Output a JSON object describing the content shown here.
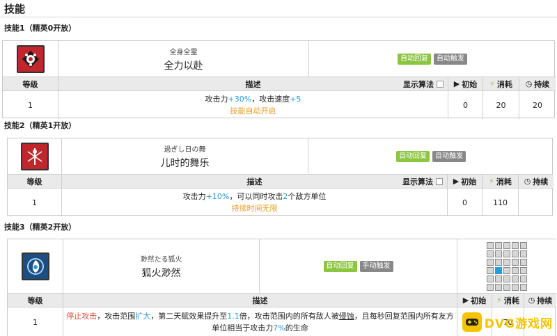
{
  "page": {
    "title": "技能"
  },
  "table_headers": {
    "level": "等级",
    "desc": "描述",
    "show_formula": "显示算法",
    "initial": "初始",
    "cost": "消耗",
    "duration": "持续"
  },
  "skills": [
    {
      "heading": "技能1（精英0开放）",
      "name_jp": "全身全霊",
      "name_cn": "全力以赴",
      "recovery_tag": "自动回复",
      "trigger_tag": "自动触发",
      "level": "1",
      "desc_line1_a": "攻击力",
      "desc_line1_b": "+30%",
      "desc_line1_c": "，攻击速度",
      "desc_line1_d": "+5",
      "desc_line2": "技能自动开启",
      "initial": "0",
      "cost": "20",
      "duration": "20",
      "icon_color": "#c0272d"
    },
    {
      "heading": "技能2（精英1开放）",
      "name_jp": "過ぎし日の舞",
      "name_cn": "儿时的舞乐",
      "recovery_tag": "自动回复",
      "trigger_tag": "自动触发",
      "level": "1",
      "desc_line1_a": "攻击力",
      "desc_line1_b": "+10%",
      "desc_line1_c": "，可以同时攻击",
      "desc_line1_d": "2",
      "desc_line1_e": "个敌方单位",
      "desc_line2": "持续时间无限",
      "initial": "0",
      "cost": "110",
      "duration": "",
      "icon_color": "#c0272d"
    },
    {
      "heading": "技能3（精英2开放）",
      "name_jp": "渺然たる狐火",
      "name_cn": "狐火渺然",
      "recovery_tag": "自动回复",
      "trigger_tag": "手动触发",
      "level": "1",
      "desc_a": "停止攻击",
      "desc_b": "，攻击范围",
      "desc_c": "扩大",
      "desc_d": "，第二天赋效果提升至",
      "desc_e": "1.1",
      "desc_f": "倍，攻击范围内的所有敌人被",
      "desc_g": "侵蚀",
      "desc_h": "，且每秒回复范围内所有友方",
      "desc_i": "单位相当于攻击力",
      "desc_j": "7%",
      "desc_k": "的生命",
      "initial": "",
      "cost": "70",
      "duration": "",
      "icon_color": "#1e4d80"
    }
  ],
  "watermark": {
    "text": "DVG游戏网"
  },
  "colors": {
    "accent_blue": "#2a9ad9",
    "accent_orange": "#e69a1e",
    "tag_green": "#8cc63f",
    "tag_grey": "#888888",
    "warn_red": "#e04b3a"
  }
}
